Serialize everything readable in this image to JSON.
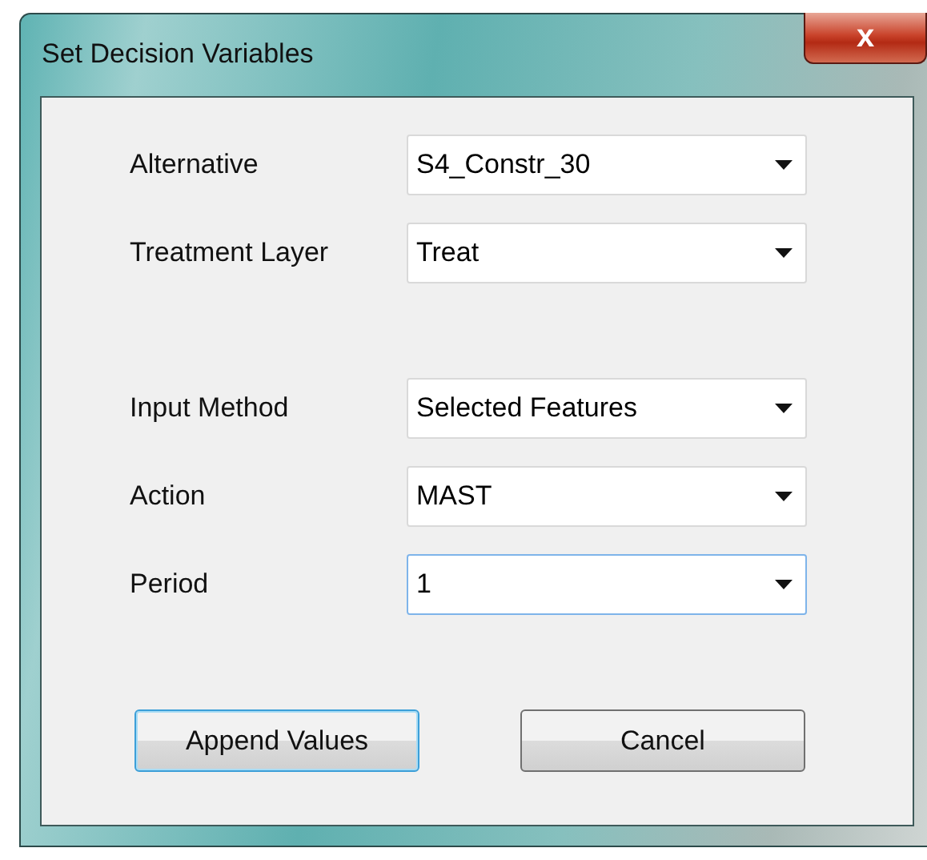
{
  "window": {
    "title": "Set Decision Variables",
    "close_label": "x"
  },
  "field_groups": [
    {
      "fields": [
        {
          "label": "Alternative",
          "value": "S4_Constr_30",
          "focused": false
        },
        {
          "label": "Treatment Layer",
          "value": "Treat",
          "focused": false
        }
      ]
    },
    {
      "fields": [
        {
          "label": "Input Method",
          "value": "Selected Features",
          "focused": false
        },
        {
          "label": "Action",
          "value": "MAST",
          "focused": false
        },
        {
          "label": "Period",
          "value": "1",
          "focused": true
        }
      ]
    }
  ],
  "buttons": [
    {
      "label": "Append Values",
      "default": true
    },
    {
      "label": "Cancel",
      "default": false
    }
  ]
}
